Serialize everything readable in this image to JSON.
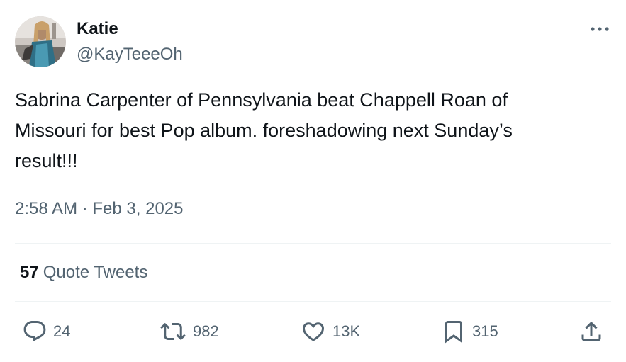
{
  "author": {
    "display_name": "Katie",
    "handle": "@KayTeeeOh"
  },
  "tweet": {
    "text": "Sabrina Carpenter of Pennsylvania beat Chappell Roan of\nMissouri for best Pop album. foreshadowing next Sunday’s\nresult!!!",
    "timestamp": "2:58 AM · Feb 3, 2025"
  },
  "quotes": {
    "count": "57",
    "label": "Quote Tweets"
  },
  "actions": {
    "replies": "24",
    "retweets": "982",
    "likes": "13K",
    "bookmarks": "315"
  },
  "icons": {
    "more": "more-icon",
    "reply": "reply-icon",
    "retweet": "retweet-icon",
    "like": "heart-icon",
    "bookmark": "bookmark-icon",
    "share": "share-icon"
  },
  "colors": {
    "text_primary": "#0f1419",
    "text_secondary": "#536471",
    "divider": "#eff3f4"
  }
}
